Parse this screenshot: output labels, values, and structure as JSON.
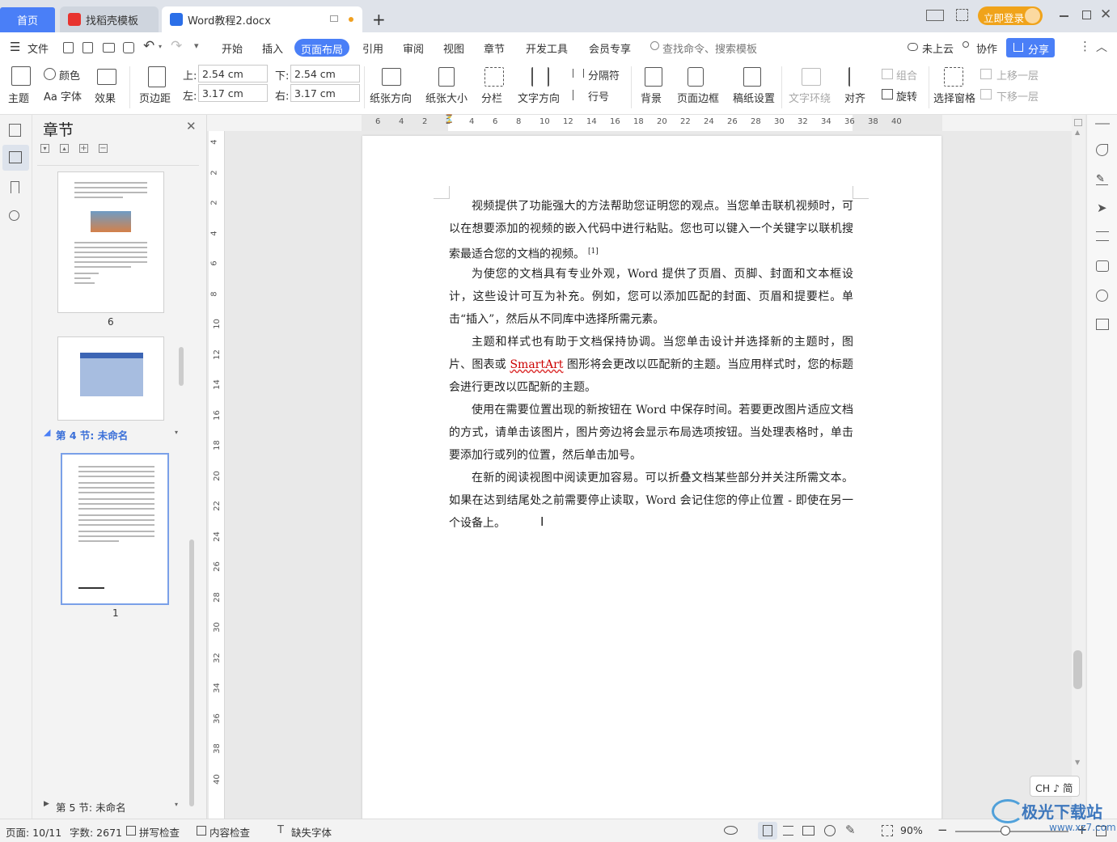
{
  "tabs": {
    "home": "首页",
    "template": "找稻壳模板",
    "document": "Word教程2.docx",
    "new_tab": "+",
    "login": "立即登录"
  },
  "menu": {
    "file": "文件",
    "items": [
      "开始",
      "插入",
      "页面布局",
      "引用",
      "审阅",
      "视图",
      "章节",
      "开发工具",
      "会员专享"
    ],
    "active": "页面布局",
    "search_placeholder": "查找命令、搜索模板",
    "cloud": "未上云",
    "collab": "协作",
    "share": "分享"
  },
  "ribbon": {
    "theme": "主题",
    "color": "颜色",
    "font": "Aa 字体",
    "effect": "效果",
    "margins": "页边距",
    "top_label": "上:",
    "top_value": "2.54 cm",
    "bottom_label": "下:",
    "bottom_value": "2.54 cm",
    "left_label": "左:",
    "left_value": "3.17 cm",
    "right_label": "右:",
    "right_value": "3.17 cm",
    "orientation": "纸张方向",
    "size": "纸张大小",
    "columns": "分栏",
    "text_dir": "文字方向",
    "breaks": "分隔符",
    "line_num": "行号",
    "background": "背景",
    "page_border": "页面边框",
    "manuscript": "稿纸设置",
    "wrap": "文字环绕",
    "align": "对齐",
    "group": "组合",
    "rotate": "旋转",
    "select_pane": "选择窗格",
    "bring_forward": "上移一层",
    "send_backward": "下移一层"
  },
  "nav": {
    "title": "章节",
    "thumb_label_6": "6",
    "section4": "第 4 节: 未命名",
    "thumb_label_1": "1",
    "section5": "第 5 节: 未命名"
  },
  "ruler": {
    "h_ticks": [
      "6",
      "4",
      "2",
      "2",
      "4",
      "6",
      "8",
      "10",
      "12",
      "14",
      "16",
      "18",
      "20",
      "22",
      "24",
      "26",
      "28",
      "30",
      "32",
      "34",
      "36",
      "38",
      "40"
    ],
    "v_ticks": [
      "4",
      "2",
      "2",
      "4",
      "6",
      "8",
      "10",
      "12",
      "14",
      "16",
      "18",
      "20",
      "22",
      "24",
      "26",
      "28",
      "30",
      "32",
      "34",
      "36",
      "38",
      "40"
    ]
  },
  "document": {
    "paragraphs": [
      "视频提供了功能强大的方法帮助您证明您的观点。当您单击联机视频时，可以在想要添加的视频的嵌入代码中进行粘贴。您也可以键入一个关键字以联机搜索最适合您的文档的视频。",
      "为使您的文档具有专业外观，Word 提供了页眉、页脚、封面和文本框设计，这些设计可互为补充。例如，您可以添加匹配的封面、页眉和提要栏。单击“插入”，然后从不同库中选择所需元素。",
      "主题和样式也有助于文档保持协调。当您单击设计并选择新的主题时，图片、图表或",
      "SmartArt",
      "图形将会更改以匹配新的主题。当应用样式时，您的标题会进行更改以匹配新的主题。",
      "使用在需要位置出现的新按钮在 Word 中保存时间。若要更改图片适应文档的方式，请单击该图片，图片旁边将会显示布局选项按钮。当处理表格时，单击要添加行或列的位置，然后单击加号。",
      "在新的阅读视图中阅读更加容易。可以折叠文档某些部分并关注所需文本。如果在达到结尾处之前需要停止读取，Word 会记住您的停止位置 - 即使在另一个设备上。"
    ],
    "footnote_ref": "[1]"
  },
  "ime": "CH ♪ 简",
  "status": {
    "page": "页面: 10/11",
    "words": "字数: 2671",
    "spell": "拼写检查",
    "content": "内容检查",
    "missing_font": "缺失字体",
    "zoom": "90%",
    "minus": "−",
    "plus": "+"
  },
  "watermark": "极光下载站",
  "watermark_url": "www.xz7.com"
}
